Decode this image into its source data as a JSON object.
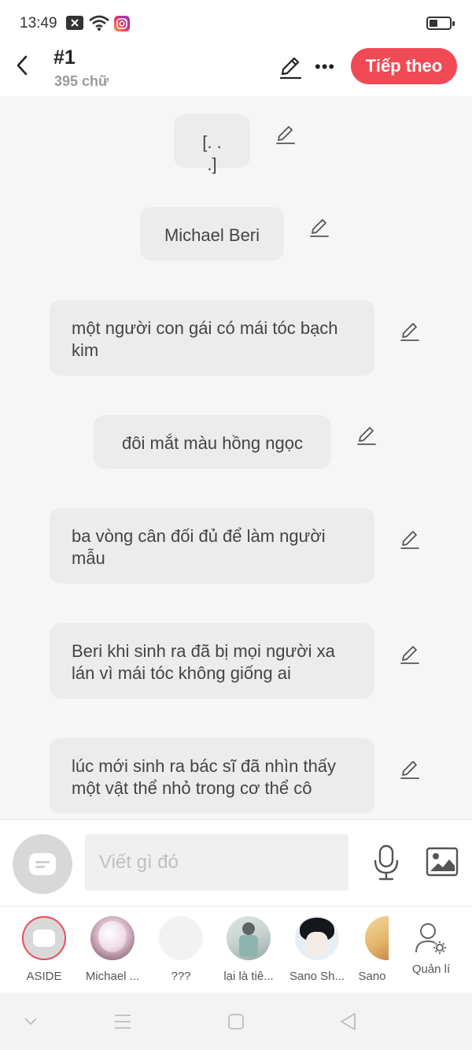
{
  "status": {
    "time": "13:49"
  },
  "header": {
    "title": "#1",
    "word_count": "395 chữ",
    "next_label": "Tiếp theo"
  },
  "messages": [
    {
      "text": "[. . .]"
    },
    {
      "text": "Michael Beri"
    },
    {
      "text": "một người con gái có mái tóc bạch kim"
    },
    {
      "text": "đôi mắt màu hồng ngọc"
    },
    {
      "text": "ba vòng cân đối đủ để làm người mẫu"
    },
    {
      "text": "Beri khi sinh ra đã bị mọi người xa lán vì mái tóc không giống ai"
    },
    {
      "text": "lúc mới sinh ra bác sĩ đã nhìn thấy một vật thể nhỏ trong cơ thể cô"
    }
  ],
  "composer": {
    "placeholder": "Viết gì đó"
  },
  "characters": [
    {
      "name": "ASIDE"
    },
    {
      "name": "Michael ..."
    },
    {
      "name": "???"
    },
    {
      "name": "lại là tiê..."
    },
    {
      "name": "Sano Sh..."
    },
    {
      "name": "Sano"
    },
    {
      "name": "Quản lí"
    }
  ],
  "colors": {
    "accent": "#f04a55",
    "bubble": "#ececec",
    "background": "#f6f6f6"
  },
  "battery": {
    "level": 0.4
  }
}
